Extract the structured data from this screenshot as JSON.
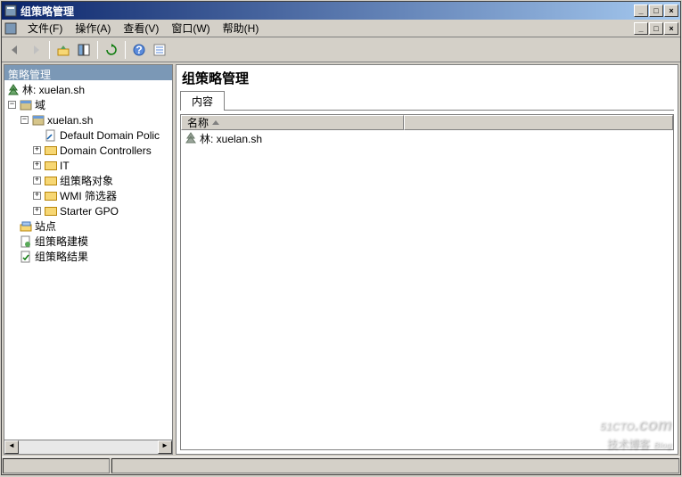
{
  "title": "组策略管理",
  "window_controls": {
    "min": "_",
    "max": "□",
    "close": "×"
  },
  "menu": {
    "file": "文件(F)",
    "action": "操作(A)",
    "view": "查看(V)",
    "window": "窗口(W)",
    "help": "帮助(H)"
  },
  "toolbar_icons": {
    "back": "back-arrow",
    "forward": "forward-arrow",
    "up": "up-level",
    "show": "show-pane",
    "refresh": "refresh",
    "help": "help",
    "props": "properties"
  },
  "tree": {
    "root": "策略管理",
    "forest": "林: xuelan.sh",
    "domains_label": "域",
    "domain": "xuelan.sh",
    "items": {
      "default_policy": "Default Domain Polic",
      "dc": "Domain Controllers",
      "it": "IT",
      "gpo_objects": "组策略对象",
      "wmi": "WMI 筛选器",
      "starter": "Starter GPO"
    },
    "sites": "站点",
    "modeling": "组策略建模",
    "results": "组策略结果"
  },
  "right": {
    "title": "组策略管理",
    "tab_content": "内容",
    "col_name": "名称",
    "row_forest": "林: xuelan.sh"
  },
  "watermark": {
    "line1": "51CTO",
    "dot": ".com",
    "line2": "技术博客",
    "sub": "Blog"
  }
}
